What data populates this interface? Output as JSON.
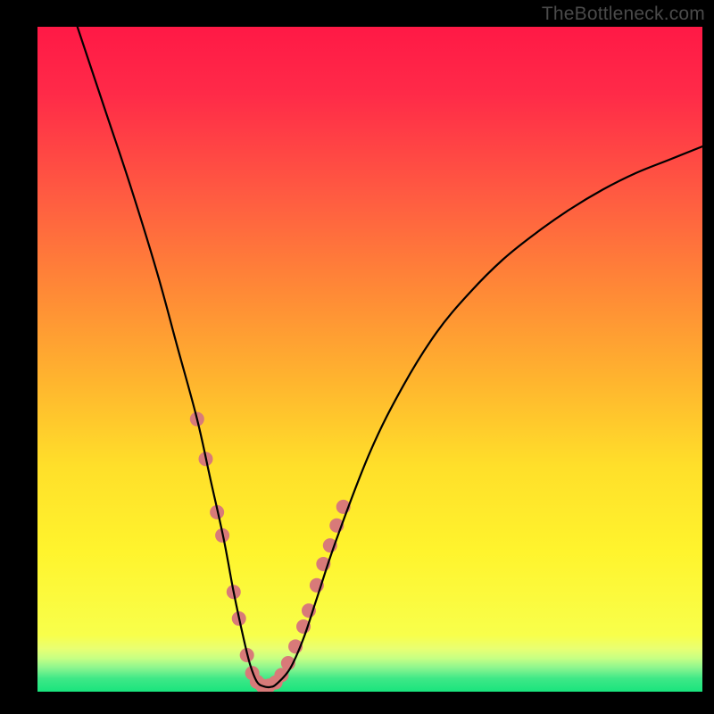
{
  "watermark": "TheBottleneck.com",
  "chart_data": {
    "type": "line",
    "title": "",
    "xlabel": "",
    "ylabel": "",
    "xlim": [
      0,
      100
    ],
    "ylim": [
      0,
      100
    ],
    "grid": false,
    "legend": false,
    "series": [
      {
        "name": "bottleneck-curve",
        "color": "#000000",
        "x": [
          6,
          10,
          14,
          18,
          21,
          24,
          26,
          28,
          29.5,
          31,
          32,
          33,
          34,
          35,
          36,
          38,
          40,
          42,
          45,
          50,
          55,
          60,
          65,
          70,
          75,
          80,
          85,
          90,
          95,
          100
        ],
        "y": [
          100,
          88,
          76,
          63,
          52,
          41,
          32,
          23,
          15,
          8,
          4,
          1.5,
          0.8,
          0.7,
          1.2,
          3.5,
          8,
          14,
          23,
          36,
          46,
          54,
          60,
          65,
          69,
          72.5,
          75.5,
          78,
          80,
          82
        ]
      }
    ],
    "markers": {
      "name": "highlight-dots",
      "color": "#d87a79",
      "radius": 8,
      "points": [
        {
          "x": 24.0,
          "y": 41.0
        },
        {
          "x": 25.3,
          "y": 35.0
        },
        {
          "x": 27.0,
          "y": 27.0
        },
        {
          "x": 27.8,
          "y": 23.5
        },
        {
          "x": 29.5,
          "y": 15.0
        },
        {
          "x": 30.3,
          "y": 11.0
        },
        {
          "x": 31.5,
          "y": 5.5
        },
        {
          "x": 32.3,
          "y": 2.8
        },
        {
          "x": 33.0,
          "y": 1.5
        },
        {
          "x": 33.8,
          "y": 0.9
        },
        {
          "x": 34.8,
          "y": 0.9
        },
        {
          "x": 35.8,
          "y": 1.4
        },
        {
          "x": 36.7,
          "y": 2.5
        },
        {
          "x": 37.7,
          "y": 4.3
        },
        {
          "x": 38.8,
          "y": 6.8
        },
        {
          "x": 40.0,
          "y": 9.8
        },
        {
          "x": 40.8,
          "y": 12.2
        },
        {
          "x": 42.0,
          "y": 16.0
        },
        {
          "x": 43.0,
          "y": 19.2
        },
        {
          "x": 44.0,
          "y": 22.0
        },
        {
          "x": 45.0,
          "y": 25.0
        },
        {
          "x": 46.0,
          "y": 27.8
        }
      ]
    }
  }
}
